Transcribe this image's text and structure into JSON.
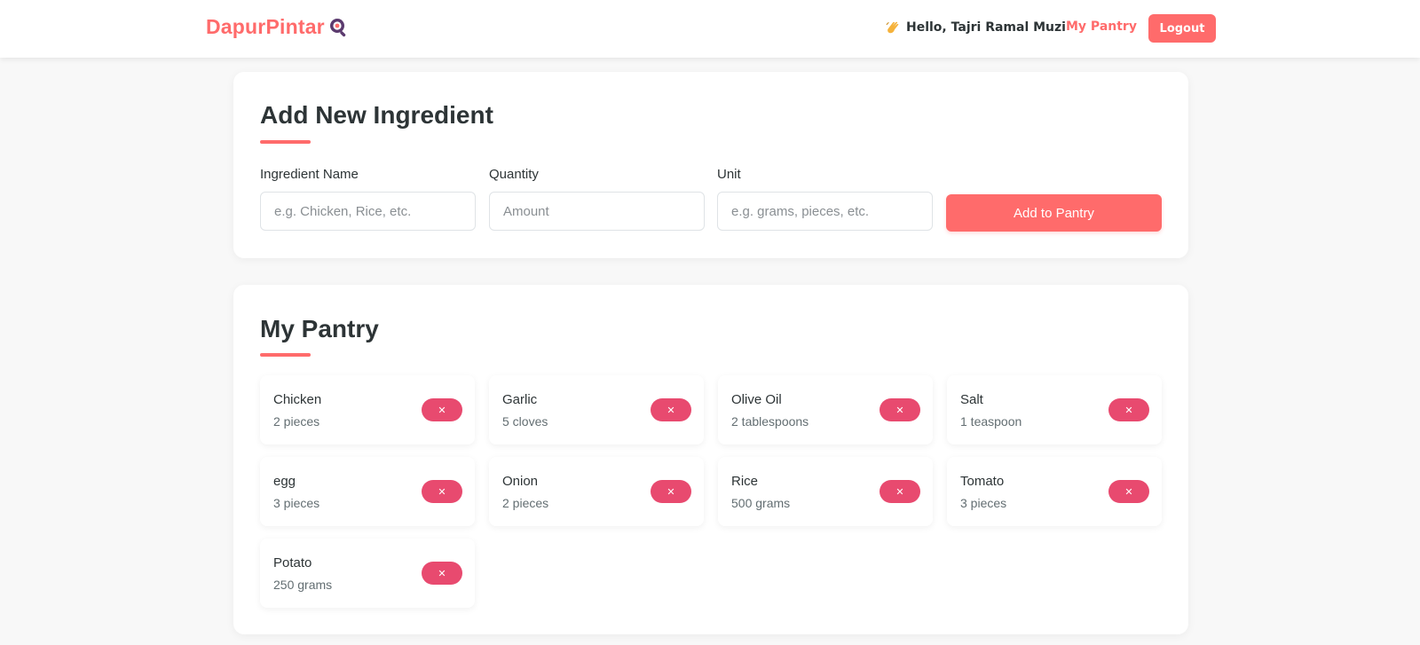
{
  "navbar": {
    "brand": "DapurPintar",
    "brand_icon": "magnifier-pan-icon",
    "greeting_icon": "waving-hand-icon",
    "greeting": "Hello, Tajri Ramal Muzi",
    "pantry_link": "My Pantry",
    "logout_label": "Logout"
  },
  "add_form": {
    "title": "Add New Ingredient",
    "name_label": "Ingredient Name",
    "name_placeholder": "e.g. Chicken, Rice, etc.",
    "name_value": "",
    "quantity_label": "Quantity",
    "quantity_placeholder": "Amount",
    "quantity_value": "",
    "unit_label": "Unit",
    "unit_placeholder": "e.g. grams, pieces, etc.",
    "unit_value": "",
    "submit_label": "Add to Pantry"
  },
  "pantry": {
    "title": "My Pantry",
    "remove_glyph": "✕",
    "items": [
      {
        "name": "Chicken",
        "quantity": "2 pieces"
      },
      {
        "name": "Garlic",
        "quantity": "5 cloves"
      },
      {
        "name": "Olive Oil",
        "quantity": "2 tablespoons"
      },
      {
        "name": "Salt",
        "quantity": "1 teaspoon"
      },
      {
        "name": "egg",
        "quantity": "3 pieces"
      },
      {
        "name": "Onion",
        "quantity": "2 pieces"
      },
      {
        "name": "Rice",
        "quantity": "500 grams"
      },
      {
        "name": "Tomato",
        "quantity": "3 pieces"
      },
      {
        "name": "Potato",
        "quantity": "250 grams"
      }
    ]
  },
  "colors": {
    "accent": "#ff6b6b",
    "remove": "#e84a6f",
    "background": "#f8f8f8",
    "text": "#2d3436"
  }
}
